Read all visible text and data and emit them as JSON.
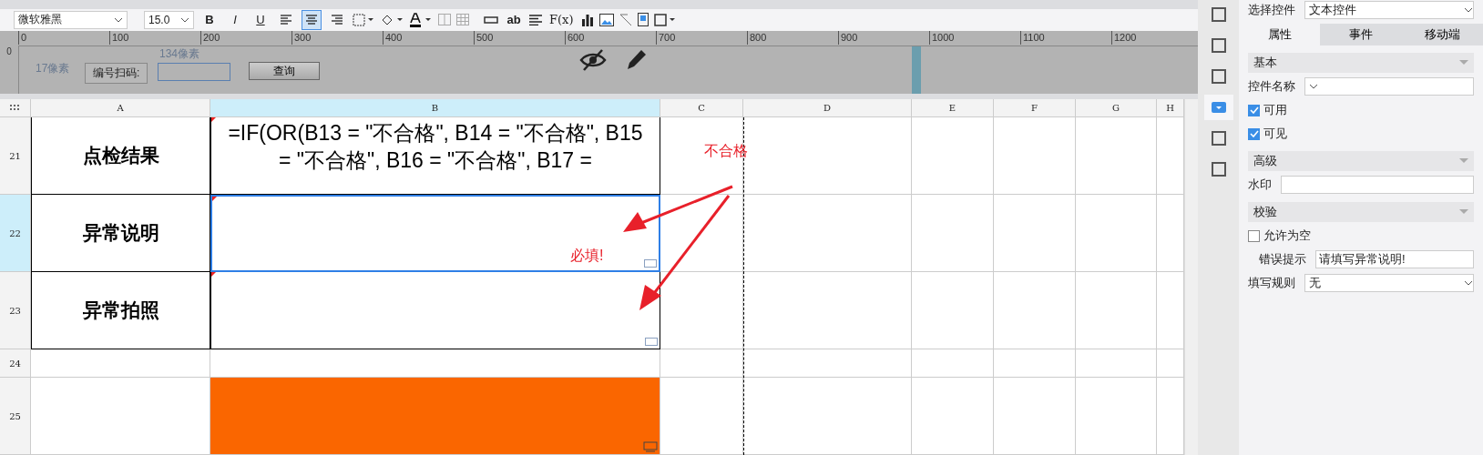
{
  "toolbar": {
    "font": "微软雅黑",
    "font_size": "15.0",
    "format_buttons": [
      "B",
      "I",
      "U"
    ],
    "align_buttons": [
      {
        "kind": "left",
        "selected": false
      },
      {
        "kind": "center",
        "selected": true
      },
      {
        "kind": "right",
        "selected": false
      }
    ],
    "widget_labels": [
      "ab",
      "F(x)"
    ]
  },
  "ruler": {
    "labels": [
      "0",
      "100",
      "200",
      "300",
      "400",
      "500",
      "600",
      "700",
      "800",
      "900",
      "1000",
      "1100",
      "1200"
    ],
    "vertical_label": "0"
  },
  "parameter_panel": {
    "height_hint": "17像素",
    "width_hint": "134像素",
    "label": "编号扫码:",
    "button": "查询"
  },
  "sheet": {
    "columns": [
      {
        "name": "A",
        "selected": false
      },
      {
        "name": "B",
        "selected": true
      },
      {
        "name": "C",
        "selected": false
      },
      {
        "name": "D",
        "selected": false
      },
      {
        "name": "E",
        "selected": false
      },
      {
        "name": "F",
        "selected": false
      },
      {
        "name": "G",
        "selected": false
      },
      {
        "name": "H",
        "selected": false
      }
    ],
    "rows": [
      {
        "number": "21",
        "selected": false,
        "kind": "bordered",
        "label": "点检结果",
        "value": "=IF(OR(B13 = \"不合格\", B14 = \"不合格\", B15 = \"不合格\", B16 = \"不合格\", B17 ="
      },
      {
        "number": "22",
        "selected": true,
        "kind": "bordered",
        "label": "异常说明"
      },
      {
        "number": "23",
        "selected": false,
        "kind": "bordered",
        "label": "异常拍照"
      },
      {
        "number": "24",
        "selected": false,
        "kind": "plain"
      },
      {
        "number": "25",
        "selected": false,
        "kind": "filled"
      }
    ]
  },
  "annotations": [
    {
      "text": "不合格"
    },
    {
      "text": "必填!"
    }
  ],
  "side_icons": [
    {
      "selected": false
    },
    {
      "selected": false
    },
    {
      "selected": false
    },
    {
      "selected": true
    },
    {
      "selected": false
    },
    {
      "selected": false
    }
  ],
  "properties": {
    "select_label": "选择控件",
    "select_value": "文本控件",
    "tabs": [
      {
        "label": "属性",
        "selected": true
      },
      {
        "label": "事件",
        "selected": false
      },
      {
        "label": "移动端",
        "selected": false
      }
    ],
    "sections": [
      {
        "title": "基本",
        "items": [
          {
            "kind": "dropdown",
            "label": "控件名称"
          },
          {
            "kind": "checkbox",
            "label": "可用",
            "checked": true
          },
          {
            "kind": "checkbox",
            "label": "可见",
            "checked": true
          }
        ]
      },
      {
        "title": "高级",
        "items": [
          {
            "kind": "field",
            "label": "水印"
          }
        ]
      },
      {
        "title": "校验",
        "items": [
          {
            "kind": "checkbox",
            "label": "允许为空",
            "checked": false
          },
          {
            "kind": "field",
            "label": "错误提示",
            "value": "请填写异常说明!"
          },
          {
            "kind": "dropdown",
            "label": "填写规则",
            "value": "无"
          }
        ]
      }
    ]
  }
}
